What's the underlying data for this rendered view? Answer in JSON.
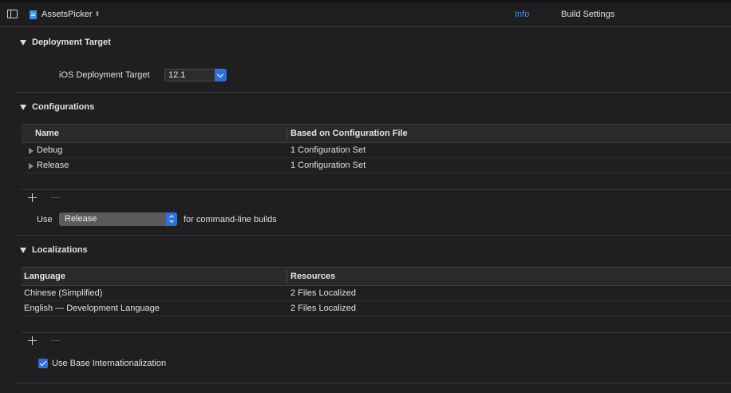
{
  "topbar": {
    "target_name": "AssetsPicker",
    "tabs": [
      {
        "label": "Info",
        "active": true
      },
      {
        "label": "Build Settings",
        "active": false
      }
    ],
    "icons": [
      "sidebar-toggle-icon",
      "project-file-icon",
      "chevron-updown-icon"
    ]
  },
  "deployment": {
    "title": "Deployment Target",
    "label": "iOS Deployment Target",
    "value": "12.1"
  },
  "configurations": {
    "title": "Configurations",
    "columns": [
      "Name",
      "Based on Configuration File"
    ],
    "rows": [
      {
        "name": "Debug",
        "file": "1 Configuration Set"
      },
      {
        "name": "Release",
        "file": "1 Configuration Set"
      }
    ],
    "use_label": "Use",
    "use_value": "Release",
    "use_suffix": "for command-line builds"
  },
  "localizations": {
    "title": "Localizations",
    "columns": [
      "Language",
      "Resources"
    ],
    "rows": [
      {
        "language": "Chinese (Simplified)",
        "resources": "2 Files Localized"
      },
      {
        "language": "English — Development Language",
        "resources": "2 Files Localized"
      }
    ],
    "checkbox_label": "Use Base Internationalization",
    "checkbox_checked": true
  },
  "colors": {
    "background": "#1f1f21",
    "accent": "#2f6fd6",
    "tab_active": "#4a90e2",
    "text": "#e0e0e0"
  }
}
